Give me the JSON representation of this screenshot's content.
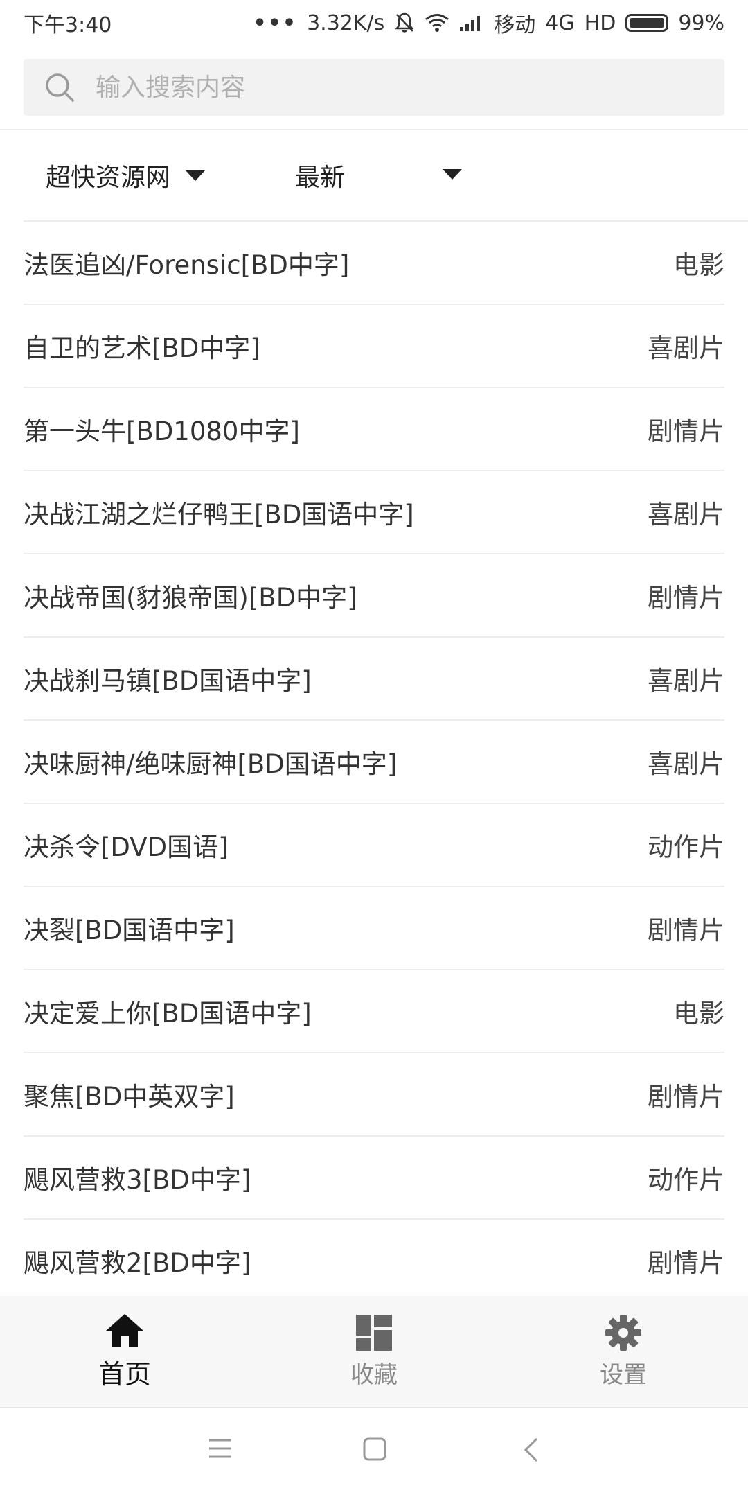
{
  "status_bar": {
    "time": "下午3:40",
    "dots": "•••",
    "network_speed": "3.32K/s",
    "carrier": "移动",
    "network_type": "4G",
    "hd": "HD",
    "battery_percent": "99%",
    "battery_level": 0.99
  },
  "search": {
    "placeholder": "输入搜索内容",
    "value": ""
  },
  "filters": {
    "source": "超快资源网",
    "sort": "最新"
  },
  "movies": [
    {
      "title": "法医追凶/Forensic[BD中字]",
      "genre": "电影"
    },
    {
      "title": "自卫的艺术[BD中字]",
      "genre": "喜剧片"
    },
    {
      "title": "第一头牛[BD1080中字]",
      "genre": "剧情片"
    },
    {
      "title": "决战江湖之烂仔鸭王[BD国语中字]",
      "genre": "喜剧片"
    },
    {
      "title": "决战帝国(豺狼帝国)[BD中字]",
      "genre": "剧情片"
    },
    {
      "title": "决战刹马镇[BD国语中字]",
      "genre": "喜剧片"
    },
    {
      "title": "决味厨神/绝味厨神[BD国语中字]",
      "genre": "喜剧片"
    },
    {
      "title": "决杀令[DVD国语]",
      "genre": "动作片"
    },
    {
      "title": "决裂[BD国语中字]",
      "genre": "剧情片"
    },
    {
      "title": "决定爱上你[BD国语中字]",
      "genre": "电影"
    },
    {
      "title": "聚焦[BD中英双字]",
      "genre": "剧情片"
    },
    {
      "title": "飓风营救3[BD中字]",
      "genre": "动作片"
    },
    {
      "title": "飓风营救2[BD中字]",
      "genre": "剧情片"
    }
  ],
  "tabs": {
    "home": {
      "label": "首页",
      "icon": "home-icon"
    },
    "favorites": {
      "label": "收藏",
      "icon": "dashboard-icon"
    },
    "settings": {
      "label": "设置",
      "icon": "gear-icon"
    }
  },
  "colors": {
    "active_tab": "#111111",
    "inactive_tab": "#888888",
    "tabbar_bg": "#f7f7f7"
  }
}
